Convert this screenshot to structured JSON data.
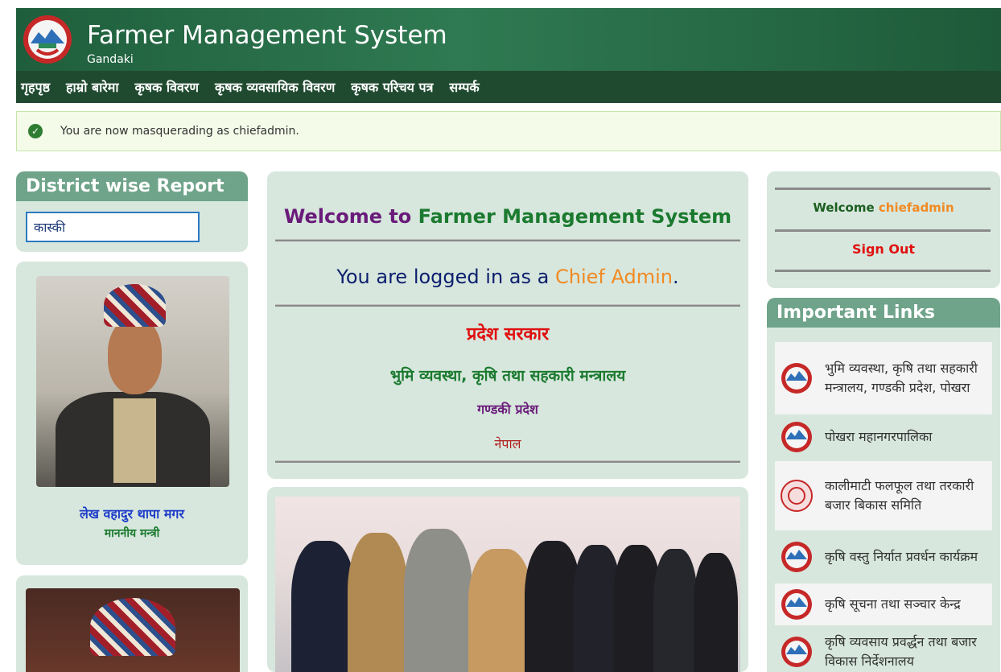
{
  "header": {
    "title": "Farmer Management System",
    "subtitle": "Gandaki"
  },
  "nav": {
    "items": [
      "गृहपृष्ठ",
      "हाम्रो बारेमा",
      "कृषक विवरण",
      "कृषक व्यवसायिक विवरण",
      "कृषक परिचय पत्र",
      "सम्पर्क"
    ]
  },
  "alert": {
    "message": "You are now masquerading as chiefadmin."
  },
  "district_report": {
    "heading": "District wise Report",
    "selected": "कास्की"
  },
  "minister": {
    "name": "लेख वहादुर थापा मगर",
    "role": "माननीय मन्त्री"
  },
  "welcome": {
    "prefix": "Welcome to",
    "system": "Farmer Management System",
    "logged_prefix": "You are logged in as a",
    "role": "Chief Admin",
    "period": ".",
    "gov": "प्रदेश सरकार",
    "ministry": "भुमि व्यवस्था, कृषि तथा सहकारी मन्त्रालय",
    "province": "गण्डकी प्रदेश",
    "country": "नेपाल"
  },
  "user_box": {
    "welcome": "Welcome",
    "username": "chiefadmin",
    "signout": "Sign Out"
  },
  "links": {
    "heading": "Important Links",
    "items": [
      "भुमि व्यवस्था, कृषि तथा सहकारी मन्त्रालय, गण्डकी प्रदेश, पोखरा",
      "पोखरा महानगरपालिका",
      "कालीमाटी फलफूल तथा तरकारी बजार बिकास समिति",
      "कृषि वस्तु निर्यात प्रवर्धन कार्यक्रम",
      "कृषि सूचना तथा सञ्चार केन्द्र",
      "कृषि व्यवसाय प्रवर्द्धन तथा बजार विकास निर्देशनालय"
    ]
  },
  "colors": {
    "header_green": "#1f5e3c",
    "panel_bg": "#d7e7dd",
    "panel_head": "#6fa48a",
    "purple": "#6a1b7a",
    "green": "#1b7a2f",
    "orange": "#f08a24",
    "red": "#e01010"
  },
  "icons": {
    "logo": "nepal-emblem-icon",
    "alert": "check-circle-icon"
  }
}
